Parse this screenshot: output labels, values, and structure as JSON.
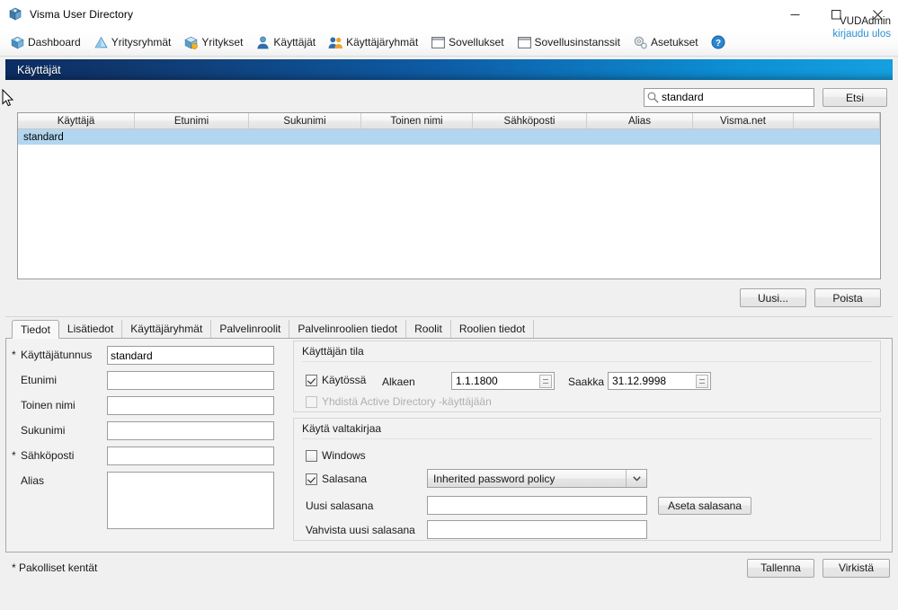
{
  "window": {
    "title": "Visma User Directory",
    "icon": "app-icon",
    "controls": {
      "minimize": "—",
      "maximize": "□",
      "close": "✕"
    }
  },
  "toolbar": {
    "items": [
      {
        "label": "Dashboard",
        "icon": "dashboard-icon"
      },
      {
        "label": "Yritysryhmät",
        "icon": "company-groups-icon"
      },
      {
        "label": "Yritykset",
        "icon": "companies-icon"
      },
      {
        "label": "Käyttäjät",
        "icon": "users-icon"
      },
      {
        "label": "Käyttäjäryhmät",
        "icon": "user-groups-icon"
      },
      {
        "label": "Sovellukset",
        "icon": "applications-icon"
      },
      {
        "label": "Sovellusinstanssit",
        "icon": "application-instances-icon"
      },
      {
        "label": "Asetukset",
        "icon": "settings-icon"
      }
    ],
    "help_icon": "help-icon",
    "user_name": "VUDAdmin",
    "logout_label": "kirjaudu ulos"
  },
  "section": {
    "header_title": "Käyttäjät"
  },
  "search": {
    "value": "standard",
    "icon": "search-icon",
    "button_label": "Etsi"
  },
  "grid": {
    "columns": [
      "Käyttäjä",
      "Etunimi",
      "Sukunimi",
      "Toinen nimi",
      "Sähköposti",
      "Alias",
      "Visma.net",
      ""
    ],
    "rows": [
      {
        "cells": [
          "standard",
          "",
          "",
          "",
          "",
          "",
          "",
          ""
        ],
        "selected": true
      }
    ],
    "new_button": "Uusi...",
    "delete_button": "Poista"
  },
  "tabs": [
    {
      "label": "Tiedot",
      "active": true
    },
    {
      "label": "Lisätiedot",
      "active": false
    },
    {
      "label": "Käyttäjäryhmät",
      "active": false
    },
    {
      "label": "Palvelinroolit",
      "active": false
    },
    {
      "label": "Palvelinroolien tiedot",
      "active": false
    },
    {
      "label": "Roolit",
      "active": false
    },
    {
      "label": "Roolien tiedot",
      "active": false
    }
  ],
  "form": {
    "fields": [
      {
        "label": "Käyttäjätunnus",
        "required": true,
        "value": "standard",
        "type": "text"
      },
      {
        "label": "Etunimi",
        "required": false,
        "value": "",
        "type": "text"
      },
      {
        "label": "Toinen nimi",
        "required": false,
        "value": "",
        "type": "text"
      },
      {
        "label": "Sukunimi",
        "required": false,
        "value": "",
        "type": "text"
      },
      {
        "label": "Sähköposti",
        "required": true,
        "value": "",
        "type": "text"
      },
      {
        "label": "Alias",
        "required": false,
        "value": "",
        "type": "textarea"
      }
    ]
  },
  "status_group": {
    "title": "Käyttäjän tila",
    "enabled_checkbox": {
      "label": "Käytössä",
      "checked": true
    },
    "from_label": "Alkaen",
    "from_value": "1.1.1800",
    "to_label": "Saakka",
    "to_value": "31.12.9998",
    "ad_checkbox": {
      "label": "Yhdistä Active Directory -käyttäjään",
      "checked": false,
      "disabled": true
    }
  },
  "credentials_group": {
    "title": "Käytä valtakirjaa",
    "windows_checkbox": {
      "label": "Windows",
      "checked": false
    },
    "password_checkbox": {
      "label": "Salasana",
      "checked": true
    },
    "policy_value": "Inherited password policy",
    "policy_options": [
      "Inherited password policy"
    ],
    "new_password_label": "Uusi salasana",
    "new_password_value": "",
    "confirm_password_label": "Vahvista uusi salasana",
    "confirm_password_value": "",
    "set_password_button": "Aseta salasana"
  },
  "footer": {
    "mandatory_note": "* Pakolliset kentät",
    "save_button": "Tallenna",
    "refresh_button": "Virkistä"
  },
  "colors": {
    "header_gradient_start": "#0d2d63",
    "header_gradient_end": "#15a0e0",
    "selection": "#b2d6ef",
    "link": "#2b8fd4",
    "panel_bg": "#f0f0f0"
  }
}
